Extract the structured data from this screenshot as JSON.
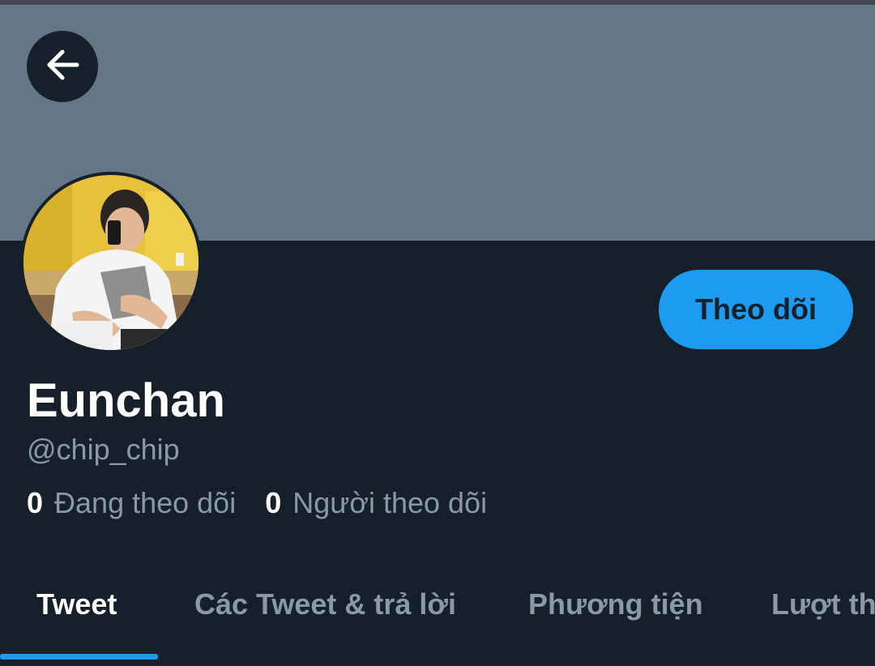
{
  "header": {
    "back_icon": "arrow-left-icon"
  },
  "profile": {
    "display_name": "Eunchan",
    "handle": "@chip_chip",
    "follow_label": "Theo dõi",
    "following_count": "0",
    "following_label": "Đang theo dõi",
    "followers_count": "0",
    "followers_label": "Người theo dõi"
  },
  "tabs": [
    {
      "label": "Tweet",
      "active": true
    },
    {
      "label": "Các Tweet & trả lời",
      "active": false
    },
    {
      "label": "Phương tiện",
      "active": false
    },
    {
      "label": "Lượt thích",
      "active": false
    }
  ],
  "colors": {
    "background": "#15202b",
    "banner": "#657786",
    "accent": "#1d9bf0",
    "muted_text": "#8b98a5"
  }
}
